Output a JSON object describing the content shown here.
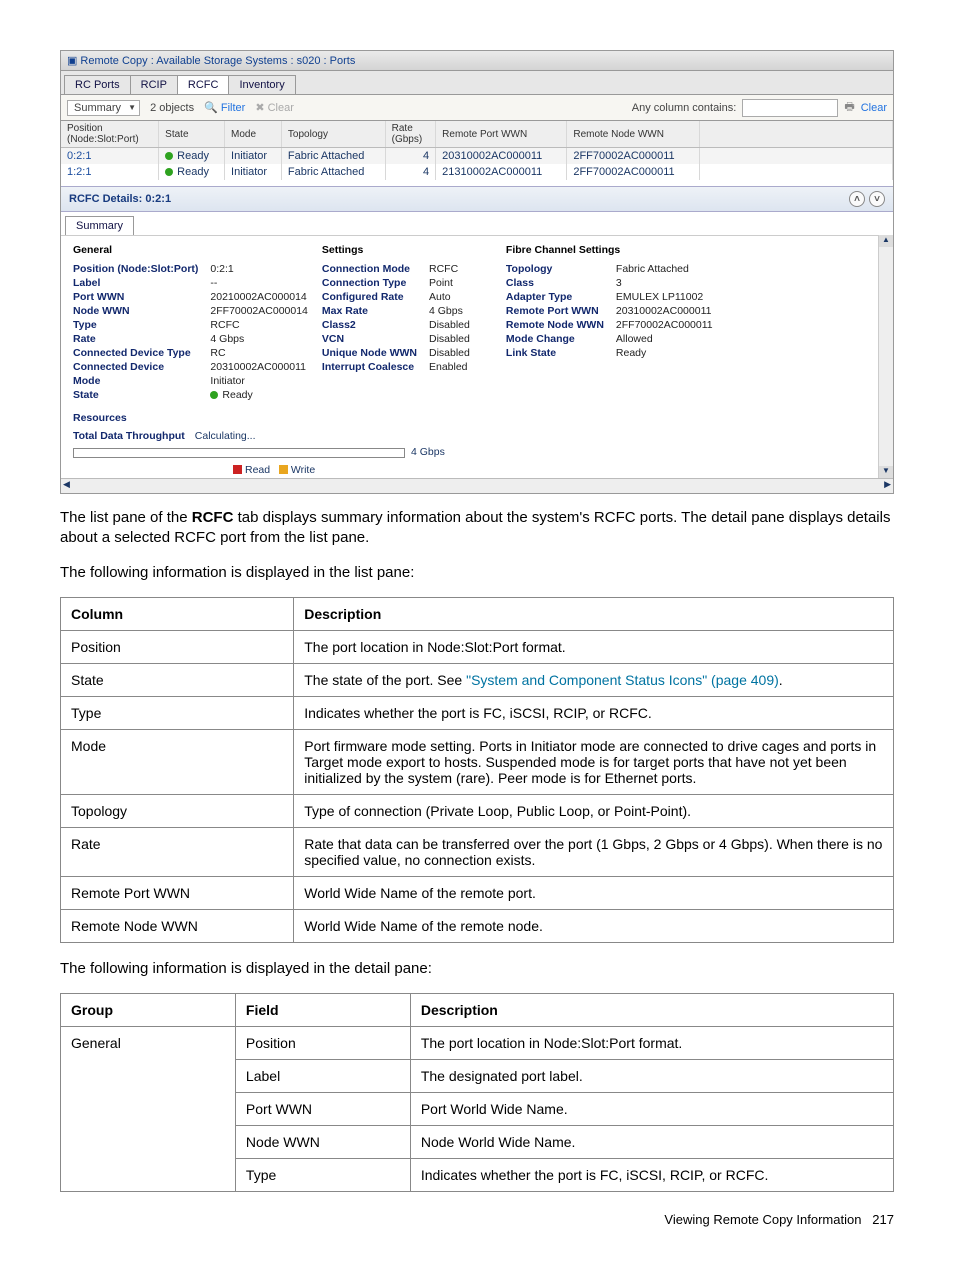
{
  "ss": {
    "title": "Remote Copy : Available Storage Systems : s020 : Ports",
    "tabs": [
      "RC Ports",
      "RCIP",
      "RCFC",
      "Inventory"
    ],
    "activeTab": "RCFC",
    "toolbar": {
      "summary": "Summary",
      "count": "2 objects",
      "filter": "Filter",
      "clear": "Clear",
      "anycol": "Any column contains:",
      "clear2": "Clear"
    },
    "gridHeaders": [
      "Position\n(Node:Slot:Port)",
      "State",
      "Mode",
      "Topology",
      "Rate\n(Gbps)",
      "Remote Port WWN",
      "Remote Node WWN"
    ],
    "gridRows": [
      {
        "pos": "0:2:1",
        "state": "Ready",
        "mode": "Initiator",
        "topology": "Fabric Attached",
        "rate": "4",
        "rpwwn": "20310002AC000011",
        "rnwwn": "2FF70002AC000011"
      },
      {
        "pos": "1:2:1",
        "state": "Ready",
        "mode": "Initiator",
        "topology": "Fabric Attached",
        "rate": "4",
        "rpwwn": "21310002AC000011",
        "rnwwn": "2FF70002AC000011"
      }
    ],
    "detailsTitle": "RCFC Details: 0:2:1",
    "subtab": "Summary",
    "general": {
      "heading": "General",
      "position": {
        "label": "Position (Node:Slot:Port)",
        "value": "0:2:1"
      },
      "label": {
        "label": "Label",
        "value": "--"
      },
      "portwwn": {
        "label": "Port WWN",
        "value": "20210002AC000014"
      },
      "nodewwn": {
        "label": "Node WWN",
        "value": "2FF70002AC000014"
      },
      "type": {
        "label": "Type",
        "value": "RCFC"
      },
      "rate": {
        "label": "Rate",
        "value": "4 Gbps"
      },
      "cdt": {
        "label": "Connected Device Type",
        "value": "RC"
      },
      "cd": {
        "label": "Connected Device",
        "value": "20310002AC000011"
      },
      "mode": {
        "label": "Mode",
        "value": "Initiator"
      },
      "state": {
        "label": "State",
        "value": "Ready"
      }
    },
    "settings": {
      "heading": "Settings",
      "cm": {
        "label": "Connection Mode",
        "value": "RCFC"
      },
      "ct": {
        "label": "Connection Type",
        "value": "Point"
      },
      "cr": {
        "label": "Configured Rate",
        "value": "Auto"
      },
      "mr": {
        "label": "Max Rate",
        "value": "4 Gbps"
      },
      "c2": {
        "label": "Class2",
        "value": "Disabled"
      },
      "vcn": {
        "label": "VCN",
        "value": "Disabled"
      },
      "unw": {
        "label": "Unique Node WWN",
        "value": "Disabled"
      },
      "ic": {
        "label": "Interrupt Coalesce",
        "value": "Enabled"
      }
    },
    "fcs": {
      "heading": "Fibre Channel Settings",
      "topology": {
        "label": "Topology",
        "value": "Fabric Attached"
      },
      "class": {
        "label": "Class",
        "value": "3"
      },
      "at": {
        "label": "Adapter Type",
        "value": "EMULEX LP11002"
      },
      "rpw": {
        "label": "Remote Port WWN",
        "value": "20310002AC000011"
      },
      "rnw": {
        "label": "Remote Node WWN",
        "value": "2FF70002AC000011"
      },
      "mc": {
        "label": "Mode Change",
        "value": "Allowed"
      },
      "ls": {
        "label": "Link State",
        "value": "Ready"
      }
    },
    "resources": {
      "heading": "Resources",
      "tdt_label": "Total Data Throughput",
      "tdt_value": "Calculating...",
      "scale": "4 Gbps",
      "legend_read": "Read",
      "legend_write": "Write"
    }
  },
  "text": {
    "p1_a": "The list pane of the ",
    "p1_b": "RCFC",
    "p1_c": " tab displays summary information about the system's RCFC ports. The detail pane displays details about a selected RCFC port from the list pane.",
    "p2": "The following information is displayed in the list pane:",
    "p3": "The following information is displayed in the detail pane:"
  },
  "table1": {
    "h1": "Column",
    "h2": "Description",
    "rows": [
      {
        "c": "Position",
        "d": "The port location in Node:Slot:Port format."
      },
      {
        "c": "State",
        "d_pre": "The state of the port. See ",
        "d_link": "\"System and Component Status Icons\" (page 409)",
        "d_post": "."
      },
      {
        "c": "Type",
        "d": "Indicates whether the port is FC, iSCSI, RCIP, or RCFC."
      },
      {
        "c": "Mode",
        "d": "Port firmware mode setting. Ports in Initiator mode are connected to drive cages and ports in Target mode export to hosts. Suspended mode is for target ports that have not yet been initialized by the system (rare). Peer mode is for Ethernet ports."
      },
      {
        "c": "Topology",
        "d": "Type of connection (Private Loop, Public Loop, or Point-Point)."
      },
      {
        "c": "Rate",
        "d": "Rate that data can be transferred over the port (1 Gbps, 2 Gbps or 4 Gbps). When there is no specified value, no connection exists."
      },
      {
        "c": "Remote Port WWN",
        "d": "World Wide Name of the remote port."
      },
      {
        "c": "Remote Node WWN",
        "d": "World Wide Name of the remote node."
      }
    ]
  },
  "table2": {
    "h1": "Group",
    "h2": "Field",
    "h3": "Description",
    "group": "General",
    "rows": [
      {
        "f": "Position",
        "d": "The port location in Node:Slot:Port format."
      },
      {
        "f": "Label",
        "d": "The designated port label."
      },
      {
        "f": "Port WWN",
        "d": "Port World Wide Name."
      },
      {
        "f": "Node WWN",
        "d": "Node World Wide Name."
      },
      {
        "f": "Type",
        "d": "Indicates whether the port is FC, iSCSI, RCIP, or RCFC."
      }
    ]
  },
  "footer": {
    "label": "Viewing Remote Copy Information",
    "page": "217"
  }
}
